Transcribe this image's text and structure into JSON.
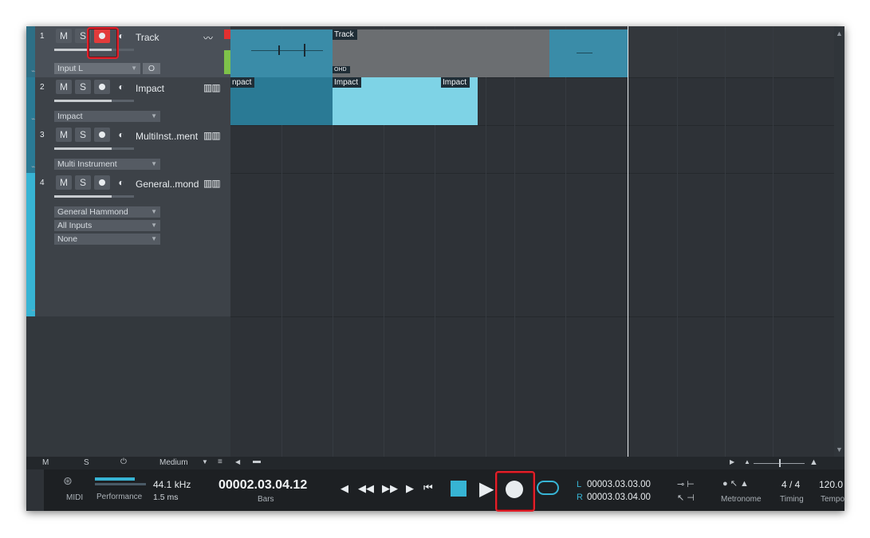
{
  "tracks": [
    {
      "num": "1",
      "m": "M",
      "s": "S",
      "name": "Track",
      "input": "Input L",
      "input_btn": "O"
    },
    {
      "num": "2",
      "m": "M",
      "s": "S",
      "name": "Impact",
      "instrument": "Impact"
    },
    {
      "num": "3",
      "m": "M",
      "s": "S",
      "name": "MultiInst..ment",
      "instrument": "Multi Instrument"
    },
    {
      "num": "4",
      "m": "M",
      "s": "S",
      "name": "General..mond",
      "instrument": "General Hammond",
      "input": "All Inputs",
      "output": "None"
    }
  ],
  "clips": {
    "track_top": "Track",
    "impact_a": "npact",
    "impact_b": "Impact",
    "impact_c": "Impact",
    "small_tag": "OHD"
  },
  "lowbar": {
    "m": "M",
    "s": "S",
    "zoom": "Medium"
  },
  "transport": {
    "midi": "MIDI",
    "performance": "Performance",
    "sample_rate": "44.1 kHz",
    "latency": "1.5 ms",
    "position": "00002.03.04.12",
    "position_unit": "Bars",
    "loop_l_prefix": "L",
    "loop_l": "00003.03.03.00",
    "loop_r_prefix": "R",
    "loop_r": "00003.03.04.00",
    "metronome": "Metronome",
    "timing_value": "4 / 4",
    "timing": "Timing",
    "tempo_value": "120.0",
    "tempo": "Tempo"
  },
  "colors": {
    "accent": "#37b4d4",
    "record": "#e23b3b",
    "highlight": "#e3202a"
  }
}
